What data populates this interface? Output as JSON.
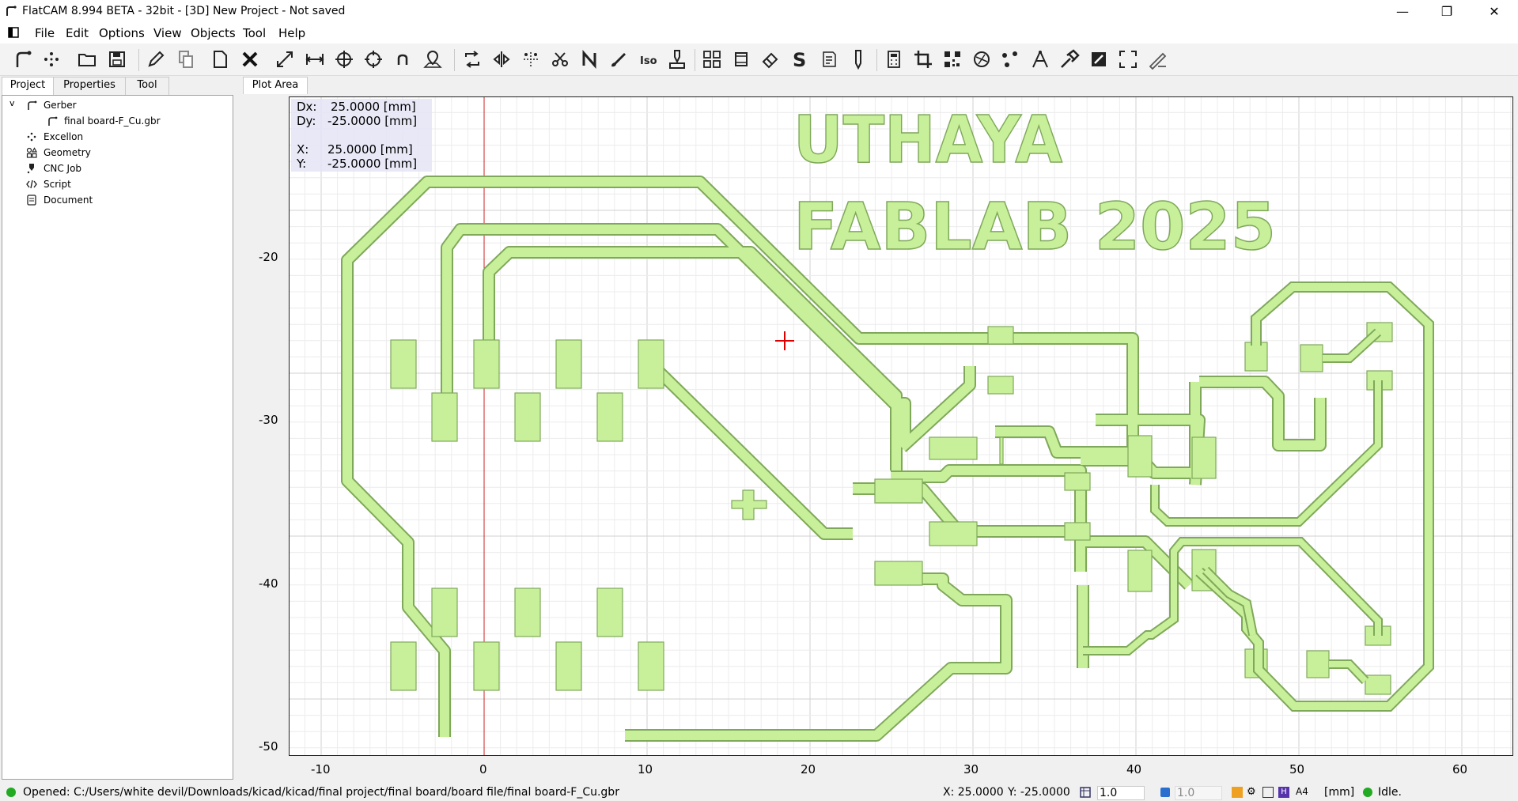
{
  "window": {
    "title": "FlatCAM 8.994 BETA - 32bit - [3D]    New Project - Not saved",
    "minimize": "—",
    "maximize": "❐",
    "close": "✕"
  },
  "menu": [
    "File",
    "Edit",
    "Options",
    "View",
    "Objects",
    "Tool",
    "Help"
  ],
  "left_tabs": [
    "Project",
    "Properties",
    "Tool"
  ],
  "project_tree": {
    "gerber": "Gerber",
    "gerber_file": "final board-F_Cu.gbr",
    "excellon": "Excellon",
    "geometry": "Geometry",
    "cnc_job": "CNC Job",
    "script": "Script",
    "document": "Document",
    "expand_glyph": "v"
  },
  "plot_tab": "Plot Area",
  "coords": {
    "dx_label": "Dx:",
    "dx": "25.0000 [mm]",
    "dy_label": "Dy:",
    "dy": "-25.0000 [mm]",
    "x_label": "X:",
    "x": "25.0000 [mm]",
    "y_label": "Y:",
    "y": "-25.0000 [mm]"
  },
  "board_text": {
    "line1": "UTHAYA",
    "line2": "FABLAB 2025"
  },
  "axis": {
    "x_ticks": [
      "-10",
      "0",
      "10",
      "20",
      "30",
      "40",
      "50",
      "60"
    ],
    "y_ticks": [
      "-20",
      "-30",
      "-40",
      "-50"
    ]
  },
  "colors": {
    "copper_fill": "#c8f09a",
    "copper_stroke": "#7fa85a",
    "grid_minor": "#ececec",
    "grid_major": "#d0d0d0",
    "origin_line": "#cc2222",
    "cursor": "#dd0000",
    "status_ok": "#22aa22"
  },
  "status": {
    "message": "Opened: C:/Users/white devil/Downloads/kicad/kicad/final project/final board/board file/final board-F_Cu.gbr",
    "x": "X: 25.0000",
    "y": "Y: -25.0000",
    "grid_x": "1.0",
    "grid_y": "1.0",
    "paper": "A4",
    "units": "[mm]",
    "state": "Idle."
  }
}
